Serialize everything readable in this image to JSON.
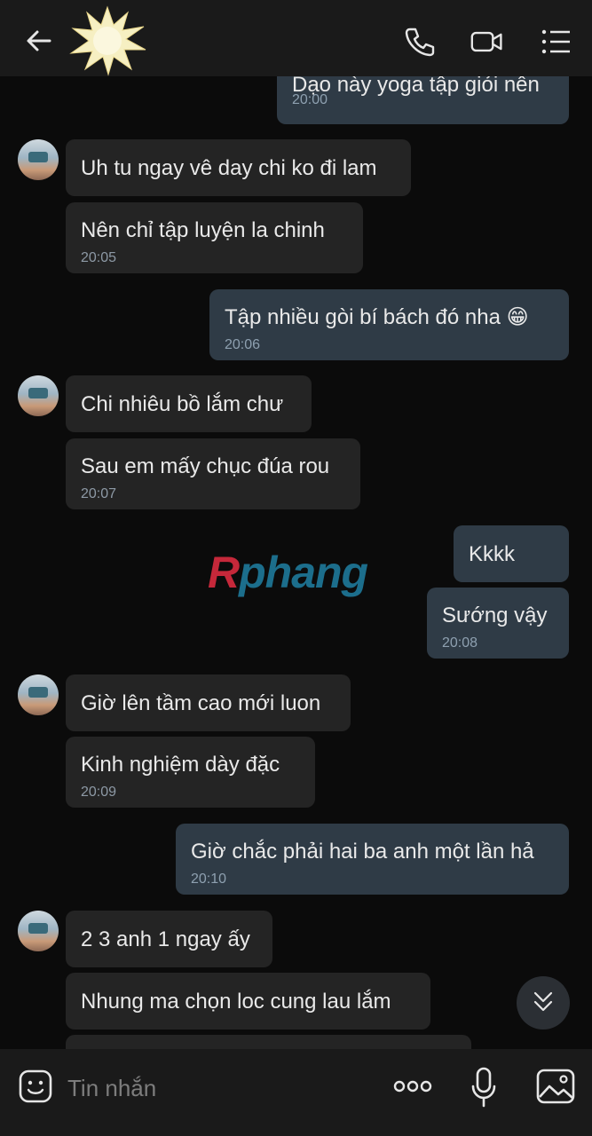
{
  "header": {
    "back": "back-icon",
    "contact_avatar": "starburst-avatar",
    "actions": [
      "phone-icon",
      "video-icon",
      "menu-list-icon"
    ]
  },
  "messages": [
    {
      "side": "out",
      "text": "Dạo này yoga tập giỏi nên",
      "time": "20:00"
    },
    {
      "side": "in",
      "text": "Uh tu ngay vê day chi ko đi lam",
      "time": ""
    },
    {
      "side": "in",
      "text": "Nên chỉ tập luyện la chinh",
      "time": "20:05"
    },
    {
      "side": "out",
      "text": "Tập nhiều gòi bí bách đó nha 😁",
      "time": "20:06"
    },
    {
      "side": "in",
      "text": "Chi nhiêu bồ lắm chư",
      "time": ""
    },
    {
      "side": "in",
      "text": "Sau em mấy chục đúa rou",
      "time": "20:07"
    },
    {
      "side": "out",
      "text": "Kkkk",
      "time": ""
    },
    {
      "side": "out",
      "text": "Sướng vậy",
      "time": "20:08"
    },
    {
      "side": "in",
      "text": "Giờ lên tầm cao mới luon",
      "time": ""
    },
    {
      "side": "in",
      "text": "Kinh nghiệm dày đặc",
      "time": "20:09"
    },
    {
      "side": "out",
      "text": "Giờ chắc phải hai ba anh một lần hả",
      "time": "20:10"
    },
    {
      "side": "in",
      "text": "2 3 anh 1 ngay ấy",
      "time": ""
    },
    {
      "side": "in",
      "text": "Nhung ma chọn loc cung lau lắm",
      "time": ""
    }
  ],
  "watermark": {
    "first": "R",
    "rest": "phang"
  },
  "composer": {
    "placeholder": "Tin nhắn"
  },
  "colors": {
    "background": "#0b0b0b",
    "bar": "#1a1a1a",
    "incoming_bubble": "#242424",
    "outgoing_bubble": "#2f3b46",
    "timestamp": "#8d99a5"
  }
}
